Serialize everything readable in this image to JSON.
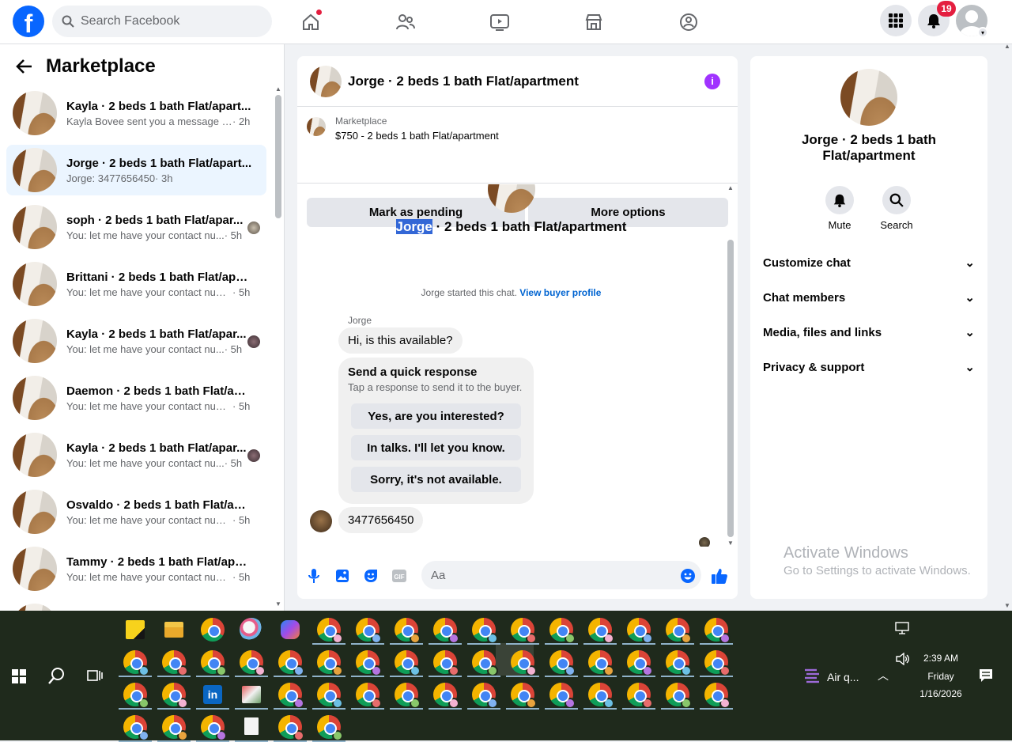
{
  "topbar": {
    "search_placeholder": "Search Facebook",
    "notification_count": "19",
    "nav_icons": [
      "home-icon",
      "friends-icon",
      "video-icon",
      "marketplace-icon",
      "groups-icon"
    ]
  },
  "sidebar": {
    "title": "Marketplace",
    "conversations": [
      {
        "name": "Kayla · 2 beds 1 bath Flat/apart...",
        "preview": "Kayla Bovee sent you a message ab...",
        "time": " · 2h"
      },
      {
        "name": "Jorge · 2 beds 1 bath Flat/apart...",
        "preview": "Jorge: 3477656450",
        "time": " · 3h"
      },
      {
        "name": "soph · 2 beds 1 bath Flat/apar...",
        "preview": "You: let me have your contact nu...",
        "time": " · 5h"
      },
      {
        "name": "Brittani · 2 beds 1 bath Flat/apar...",
        "preview": "You: let me have your contact num...",
        "time": " · 5h"
      },
      {
        "name": "Kayla · 2 beds 1 bath Flat/apar...",
        "preview": "You: let me have your contact nu...",
        "time": " · 5h"
      },
      {
        "name": "Daemon · 2 beds 1 bath Flat/apa...",
        "preview": "You: let me have your contact num...",
        "time": " · 5h"
      },
      {
        "name": "Kayla · 2 beds 1 bath Flat/apar...",
        "preview": "You: let me have your contact nu...",
        "time": " · 5h"
      },
      {
        "name": "Osvaldo · 2 beds 1 bath Flat/apa...",
        "preview": "You: let me have your contact num...",
        "time": " · 5h"
      },
      {
        "name": "Tammy · 2 beds 1 bath Flat/apar...",
        "preview": "You: let me have your contact num...",
        "time": " · 5h"
      }
    ]
  },
  "chat": {
    "title": "Jorge · 2 beds 1 bath Flat/apartment",
    "listing_source": "Marketplace",
    "listing_price": "$750 - 2 beds 1 bath Flat/apartment",
    "mark_pending": "Mark as pending",
    "more_options": "More options",
    "hero_name": "Jorge",
    "hero_rest": " · 2 beds 1 bath Flat/apartment",
    "started_text": "Jorge started this chat.",
    "view_buyer": "View buyer profile",
    "sender": "Jorge",
    "msg1": "Hi, is this available?",
    "quick_title": "Send a quick response",
    "quick_sub": "Tap a response to send it to the buyer.",
    "quick_replies": [
      "Yes, are you interested?",
      "In talks. I'll let you know.",
      "Sorry, it's not available."
    ],
    "msg2": "3477656450",
    "input_placeholder": "Aa"
  },
  "details": {
    "title": "Jorge · 2 beds 1 bath Flat/apartment",
    "mute": "Mute",
    "search": "Search",
    "sections": [
      "Customize chat",
      "Chat members",
      "Media, files and links",
      "Privacy & support"
    ]
  },
  "watermark": {
    "line1": "Activate Windows",
    "line2": "Go to Settings to activate Windows."
  },
  "taskbar": {
    "weather": "Air q...",
    "time": "2:39 AM",
    "day": "Friday",
    "date": "1/16/2026"
  },
  "colors": {
    "brand": "#0866ff",
    "accent_purple": "#a033ff",
    "link": "#0064d1"
  }
}
